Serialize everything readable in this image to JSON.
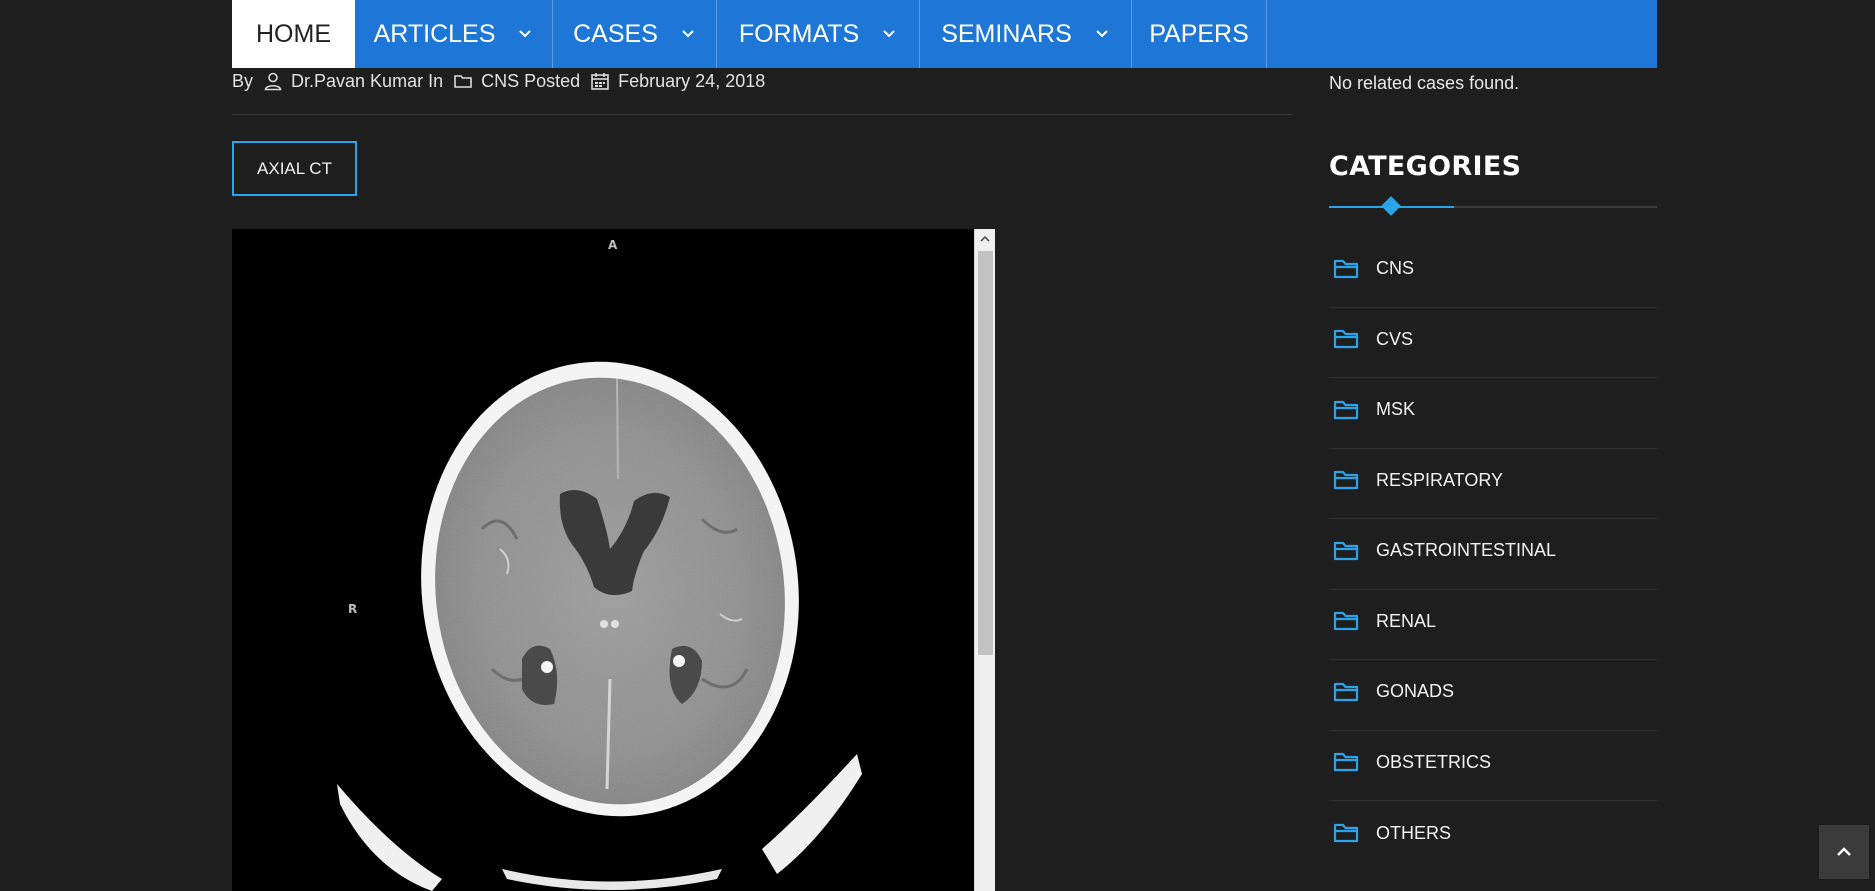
{
  "nav": {
    "items": [
      {
        "label": "HOME"
      },
      {
        "label": "ARTICLES"
      },
      {
        "label": "CASES"
      },
      {
        "label": "FORMATS"
      },
      {
        "label": "SEMINARS"
      },
      {
        "label": "PAPERS"
      }
    ]
  },
  "post_meta": {
    "by_label": "By",
    "author": "Dr.Pavan Kumar In",
    "category_text": "CNS Posted",
    "date": "February 24, 2018"
  },
  "viewer": {
    "tab_label": "AXIAL CT",
    "orientation_top": "A",
    "orientation_left": "R"
  },
  "sidebar": {
    "no_related": "No related cases found.",
    "categories_title": "CATEGORIES",
    "categories": [
      {
        "label": "CNS"
      },
      {
        "label": "CVS"
      },
      {
        "label": "MSK"
      },
      {
        "label": "RESPIRATORY"
      },
      {
        "label": "GASTROINTESTINAL"
      },
      {
        "label": "RENAL"
      },
      {
        "label": "GONADS"
      },
      {
        "label": "OBSTETRICS"
      },
      {
        "label": "OTHERS"
      }
    ]
  },
  "colors": {
    "nav_bg": "#1e77d6",
    "accent": "#2aa3e8",
    "page_bg": "#1e1e1e"
  },
  "icons": {
    "author": "user-icon",
    "category": "folder-icon",
    "date": "calendar-icon",
    "dropdown": "chevron-down-icon",
    "back_to_top": "chevron-up-icon"
  }
}
